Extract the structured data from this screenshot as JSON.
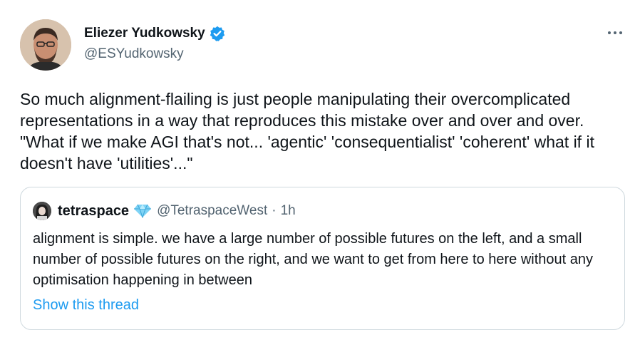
{
  "author": {
    "display_name": "Eliezer Yudkowsky",
    "handle": "@ESYudkowsky",
    "avatar_icon": "profile-photo",
    "verified_icon": "verified-badge-icon",
    "verified_color": "#1d9bf0"
  },
  "tweet": {
    "text": "So much alignment-flailing is just people manipulating their overcomplicated representations in a way that reproduces this mistake over and over and over.  \"What if we make AGI that's not... 'agentic' 'consequentialist' 'coherent' what if it doesn't have 'utilities'...\""
  },
  "more_menu_icon": "more-options-icon",
  "quote": {
    "display_name": "tetraspace",
    "badge_icon": "diamond-emoji-icon",
    "handle": "@TetraspaceWest",
    "separator": "·",
    "time": "1h",
    "text": "alignment is simple. we have a large number of possible futures on the left, and a small number of possible futures on the right, and we want to get from here to here without any optimisation happening in between",
    "show_thread_label": "Show this thread",
    "link_color": "#1d9bf0"
  }
}
